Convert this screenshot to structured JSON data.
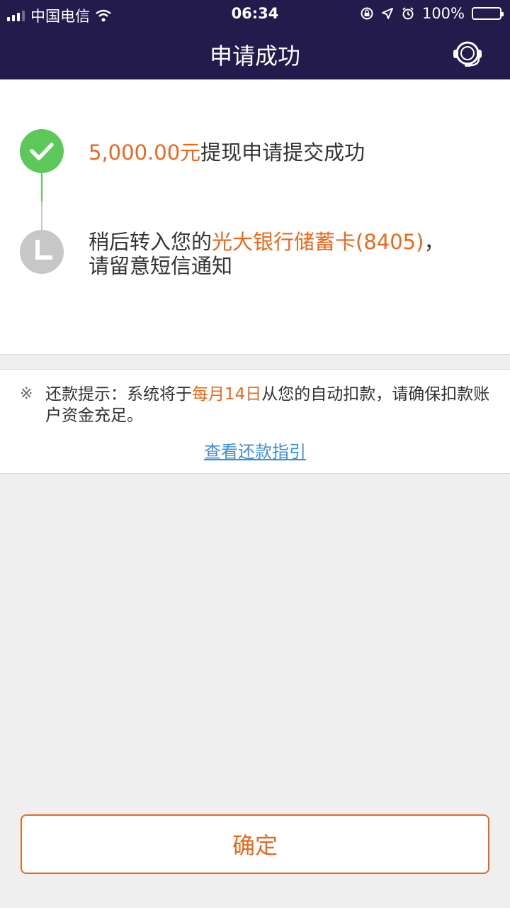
{
  "status_bar": {
    "carrier": "中国电信",
    "time": "06:34",
    "battery": "100%"
  },
  "nav": {
    "title": "申请成功",
    "service_icon": "customer-service-headset-icon"
  },
  "steps": {
    "step1": {
      "amount": "5,000.00元",
      "text": "提现申请提交成功",
      "icon": "check-circle-icon"
    },
    "step2": {
      "prefix": "稍后转入您的",
      "bank": "光大银行储蓄卡(8405)",
      "suffix": "，",
      "line2": "请留意短信通知",
      "icon": "clock-icon"
    }
  },
  "notice": {
    "mark": "※",
    "label": "还款提示：系统将于",
    "date": "每月14日",
    "text_after": "从您的自动扣款，请确保扣款账户资金充足。",
    "link": "查看还款指引"
  },
  "confirm_label": "确定",
  "colors": {
    "header_bg": "#231b4b",
    "accent_orange": "#e8681e",
    "success_green": "#5cc85a",
    "pending_gray": "#c7c7c7",
    "link_blue": "#3d8fd6"
  }
}
